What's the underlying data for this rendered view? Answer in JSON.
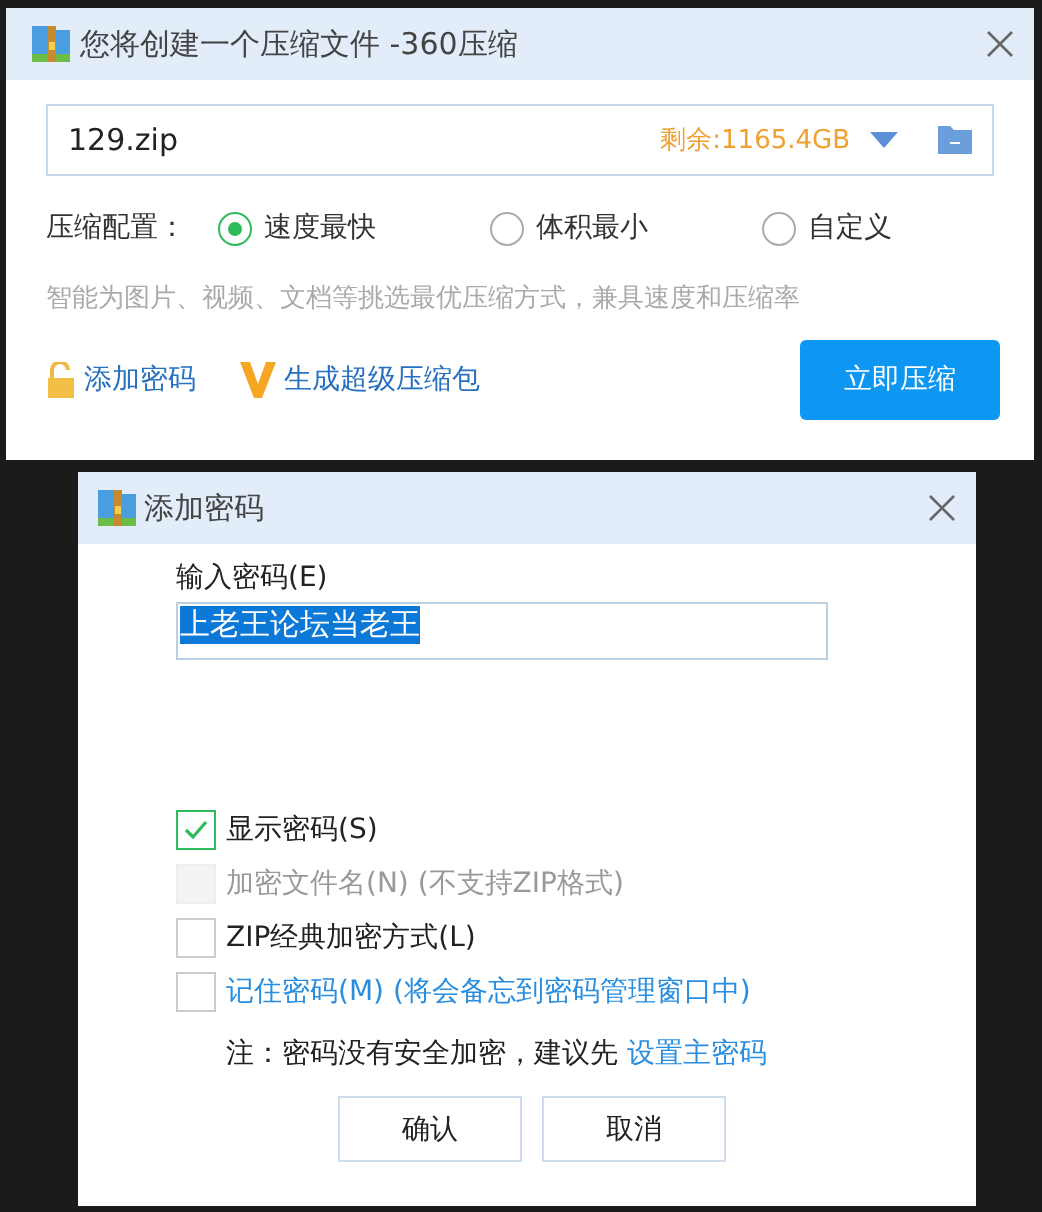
{
  "compress_dialog": {
    "title": "您将创建一个压缩文件 -360压缩",
    "filename": "129.zip",
    "free_space": "剩余:1165.4GB",
    "config_label": "压缩配置：",
    "options": [
      {
        "label": "速度最快",
        "selected": true
      },
      {
        "label": "体积最小",
        "selected": false
      },
      {
        "label": "自定义",
        "selected": false
      }
    ],
    "hint": "智能为图片、视频、文档等挑选最优压缩方式，兼具速度和压缩率",
    "add_password": "添加密码",
    "super_package": "生成超级压缩包",
    "compress_button": "立即压缩"
  },
  "password_dialog": {
    "title": "添加密码",
    "input_label": "输入密码(E)",
    "password": "上老王论坛当老王",
    "text_selected": true,
    "options": [
      {
        "label": "显示密码(S)",
        "checked": true,
        "disabled": false,
        "kind": "plain"
      },
      {
        "label": "加密文件名(N) (不支持ZIP格式)",
        "checked": false,
        "disabled": true,
        "kind": "plain"
      },
      {
        "label": "ZIP经典加密方式(L)",
        "checked": false,
        "disabled": false,
        "kind": "plain"
      },
      {
        "label": "记住密码(M) (将会备忘到密码管理窗口中)",
        "checked": false,
        "disabled": false,
        "kind": "link"
      }
    ],
    "note": "注：密码没有安全加密，建议先",
    "note_link": "设置主密码",
    "buttons": [
      "确认",
      "取消"
    ]
  }
}
